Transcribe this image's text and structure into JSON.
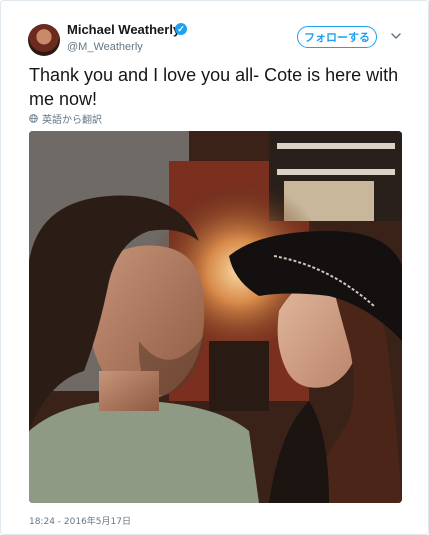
{
  "tweet": {
    "display_name": "Michael Weatherly",
    "handle": "@M_Weatherly",
    "verified_mark": "✓",
    "follow_label": "フォローする",
    "text": "Thank you and I love you all- Cote is here with me now!",
    "translate_label": "英語から翻訳",
    "timestamp": "18:24 - 2016年5月17日"
  },
  "icons": {
    "verified": "verified-badge-icon",
    "caret": "chevron-down-icon",
    "globe": "globe-icon"
  },
  "colors": {
    "accent": "#1da1f2",
    "muted": "#657786",
    "text": "#14171a"
  }
}
